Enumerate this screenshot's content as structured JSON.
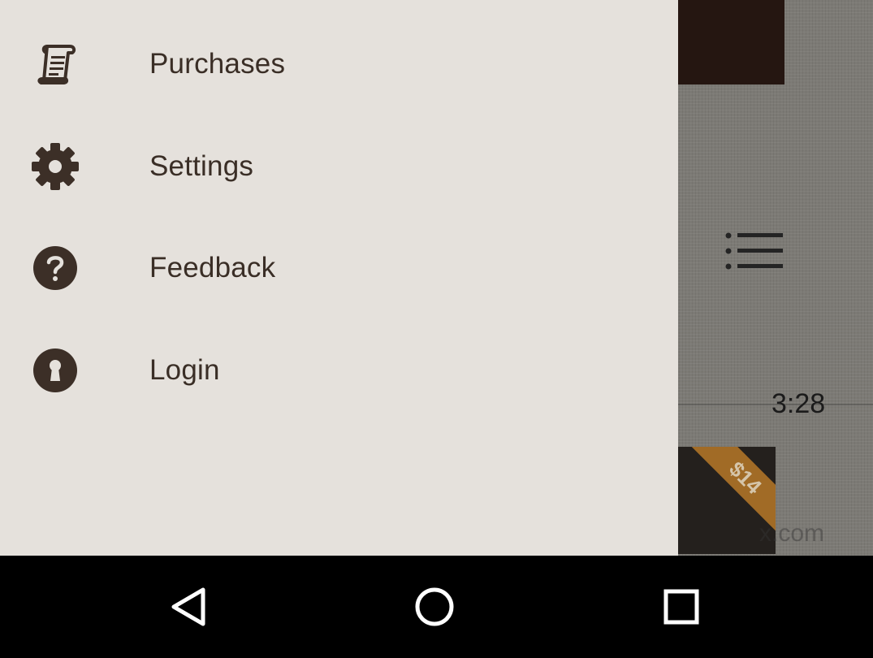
{
  "drawer": {
    "items": [
      {
        "label": "Purchases",
        "icon": "scroll-icon"
      },
      {
        "label": "Settings",
        "icon": "gear-icon"
      },
      {
        "label": "Feedback",
        "icon": "help-circle-icon"
      },
      {
        "label": "Login",
        "icon": "keyhole-icon"
      }
    ],
    "background_color": "#e5e1dc",
    "text_color": "#3a2e26",
    "icon_color": "#3c2f27"
  },
  "background_app": {
    "duration": "3:28",
    "price_badge": "$14",
    "watermark": "x.com",
    "list_icon": "list-icon"
  },
  "navigation_bar": {
    "buttons": [
      {
        "name": "back",
        "icon": "back-triangle-icon"
      },
      {
        "name": "home",
        "icon": "home-circle-icon"
      },
      {
        "name": "recents",
        "icon": "recents-square-icon"
      }
    ]
  }
}
